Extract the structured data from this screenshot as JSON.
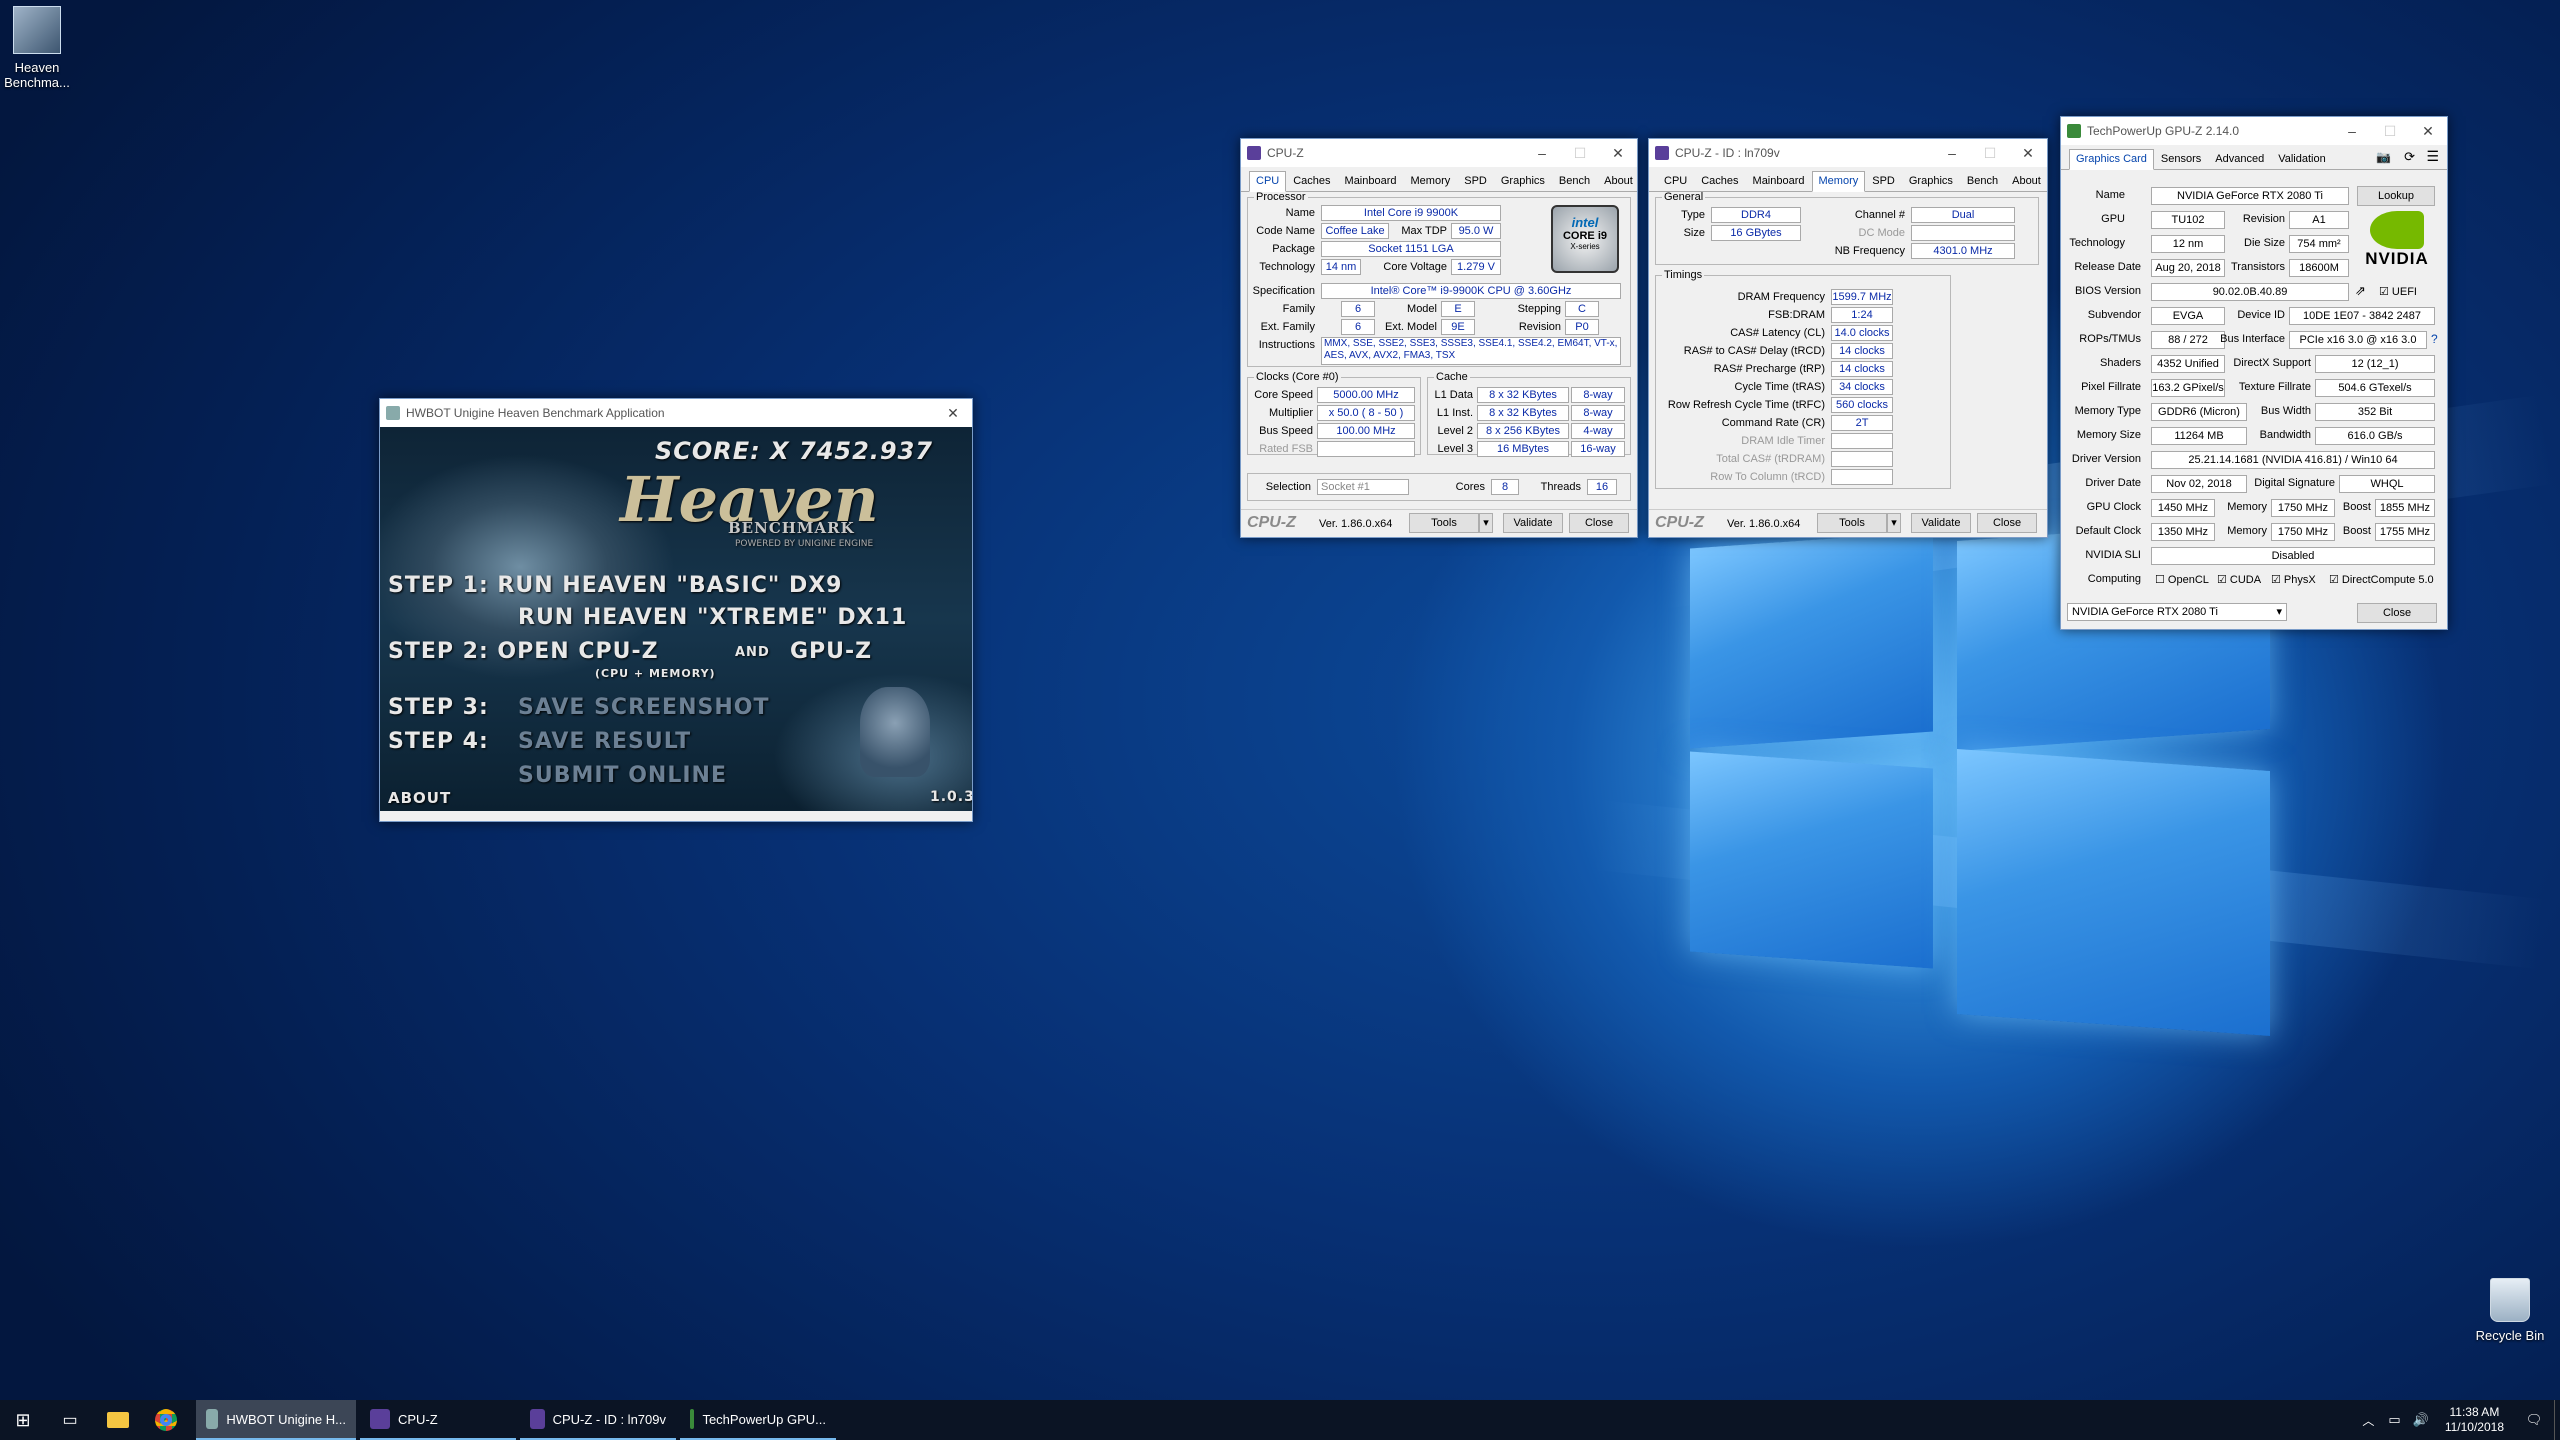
{
  "desktop": {
    "icons": [
      {
        "label": "Heaven Benchma..."
      },
      {
        "label": "Recycle Bin"
      }
    ]
  },
  "heaven": {
    "title": "HWBOT Unigine Heaven Benchmark Application",
    "score": "SCORE: X 7452.937",
    "logo": "Heaven",
    "logo_sub": "BENCHMARK",
    "logo_by": "POWERED BY UNIGINE ENGINE",
    "step1a": "STEP 1:  RUN HEAVEN \"BASIC\" DX9",
    "step1b": "RUN HEAVEN \"XTREME\" DX11",
    "step2": "STEP 2: OPEN CPU-Z",
    "step2and": "AND",
    "step2b": "GPU-Z",
    "step2sub": "(CPU + MEMORY)",
    "step3": "STEP 3:",
    "step3b": "SAVE SCREENSHOT",
    "step4": "STEP 4:",
    "step4b": "SAVE RESULT",
    "submit": "SUBMIT ONLINE",
    "about": "ABOUT",
    "version": "1.0.3"
  },
  "cpuz1": {
    "title": "CPU-Z",
    "tabs": [
      "CPU",
      "Caches",
      "Mainboard",
      "Memory",
      "SPD",
      "Graphics",
      "Bench",
      "About"
    ],
    "processor": "Processor",
    "name_l": "Name",
    "name": "Intel Core i9 9900K",
    "codename_l": "Code Name",
    "codename": "Coffee Lake",
    "maxtdp_l": "Max TDP",
    "maxtdp": "95.0 W",
    "package_l": "Package",
    "package": "Socket 1151 LGA",
    "tech_l": "Technology",
    "tech": "14 nm",
    "cv_l": "Core Voltage",
    "cv": "1.279 V",
    "spec_l": "Specification",
    "spec": "Intel® Core™ i9-9900K CPU @ 3.60GHz",
    "family_l": "Family",
    "family": "6",
    "model_l": "Model",
    "model": "E",
    "stepping_l": "Stepping",
    "stepping": "C",
    "extfam_l": "Ext. Family",
    "extfam": "6",
    "extmodel_l": "Ext. Model",
    "extmodel": "9E",
    "rev_l": "Revision",
    "rev": "P0",
    "instr_l": "Instructions",
    "instr1": "MMX, SSE, SSE2, SSE3, SSSE3, SSE4.1, SSE4.2, EM64T, VT-x,",
    "instr2": "AES, AVX, AVX2, FMA3, TSX",
    "clocks": "Clocks (Core #0)",
    "cache": "Cache",
    "corespeed_l": "Core Speed",
    "corespeed": "5000.00 MHz",
    "mult_l": "Multiplier",
    "mult": "x 50.0 ( 8 - 50 )",
    "bus_l": "Bus Speed",
    "bus": "100.00 MHz",
    "ratedfsb_l": "Rated FSB",
    "l1d_l": "L1 Data",
    "l1d": "8 x 32 KBytes",
    "l1d_w": "8-way",
    "l1i_l": "L1 Inst.",
    "l1i": "8 x 32 KBytes",
    "l1i_w": "8-way",
    "l2_l": "Level 2",
    "l2": "8 x 256 KBytes",
    "l2_w": "4-way",
    "l3_l": "Level 3",
    "l3": "16 MBytes",
    "l3_w": "16-way",
    "selection_l": "Selection",
    "selection": "Socket #1",
    "cores_l": "Cores",
    "cores": "8",
    "threads_l": "Threads",
    "threads": "16",
    "logo": "CPU-Z",
    "version": "Ver. 1.86.0.x64",
    "tools": "Tools",
    "validate": "Validate",
    "close": "Close",
    "intel_badge": "intel",
    "intel_core": "CORE i9",
    "intel_x": "X-series"
  },
  "cpuz2": {
    "title": "CPU-Z - ID : ln709v",
    "tabs": [
      "CPU",
      "Caches",
      "Mainboard",
      "Memory",
      "SPD",
      "Graphics",
      "Bench",
      "About"
    ],
    "general": "General",
    "type_l": "Type",
    "type": "DDR4",
    "channel_l": "Channel #",
    "channel": "Dual",
    "size_l": "Size",
    "size": "16 GBytes",
    "dcmode_l": "DC Mode",
    "nbfreq_l": "NB Frequency",
    "nbfreq": "4301.0 MHz",
    "timings": "Timings",
    "t": [
      {
        "l": "DRAM Frequency",
        "v": "1599.7 MHz"
      },
      {
        "l": "FSB:DRAM",
        "v": "1:24"
      },
      {
        "l": "CAS# Latency (CL)",
        "v": "14.0 clocks"
      },
      {
        "l": "RAS# to CAS# Delay (tRCD)",
        "v": "14 clocks"
      },
      {
        "l": "RAS# Precharge (tRP)",
        "v": "14 clocks"
      },
      {
        "l": "Cycle Time (tRAS)",
        "v": "34 clocks"
      },
      {
        "l": "Row Refresh Cycle Time (tRFC)",
        "v": "560 clocks"
      },
      {
        "l": "Command Rate (CR)",
        "v": "2T"
      },
      {
        "l": "DRAM Idle Timer",
        "v": ""
      },
      {
        "l": "Total CAS# (tRDRAM)",
        "v": ""
      },
      {
        "l": "Row To Column (tRCD)",
        "v": ""
      }
    ],
    "logo": "CPU-Z",
    "version": "Ver. 1.86.0.x64",
    "tools": "Tools",
    "validate": "Validate",
    "close": "Close"
  },
  "gpuz": {
    "title": "TechPowerUp GPU-Z 2.14.0",
    "tabs": [
      "Graphics Card",
      "Sensors",
      "Advanced",
      "Validation"
    ],
    "name_l": "Name",
    "name": "NVIDIA GeForce RTX 2080 Ti",
    "lookup": "Lookup",
    "gpu_l": "GPU",
    "gpu": "TU102",
    "rev_l": "Revision",
    "rev": "A1",
    "tech_l": "Technology",
    "tech": "12 nm",
    "die_l": "Die Size",
    "die": "754 mm²",
    "release_l": "Release Date",
    "release": "Aug 20, 2018",
    "trans_l": "Transistors",
    "trans": "18600M",
    "bios_l": "BIOS Version",
    "bios": "90.02.0B.40.89",
    "uefi": "UEFI",
    "subv_l": "Subvendor",
    "subv": "EVGA",
    "devid_l": "Device ID",
    "devid": "10DE 1E07 - 3842 2487",
    "rops_l": "ROPs/TMUs",
    "rops": "88 / 272",
    "busif_l": "Bus Interface",
    "busif": "PCIe x16 3.0 @ x16 3.0",
    "shaders_l": "Shaders",
    "shaders": "4352 Unified",
    "dx_l": "DirectX Support",
    "dx": "12 (12_1)",
    "pixel_l": "Pixel Fillrate",
    "pixel": "163.2 GPixel/s",
    "texture_l": "Texture Fillrate",
    "texture": "504.6 GTexel/s",
    "memtype_l": "Memory Type",
    "memtype": "GDDR6 (Micron)",
    "buswidth_l": "Bus Width",
    "buswidth": "352 Bit",
    "memsize_l": "Memory Size",
    "memsize": "11264 MB",
    "bw_l": "Bandwidth",
    "bw": "616.0 GB/s",
    "driver_l": "Driver Version",
    "driver": "25.21.14.1681 (NVIDIA 416.81) / Win10 64",
    "ddate_l": "Driver Date",
    "ddate": "Nov 02, 2018",
    "dsig_l": "Digital Signature",
    "dsig": "WHQL",
    "gpuclk_l": "GPU Clock",
    "gpuclk": "1450 MHz",
    "mem_l": "Memory",
    "mem": "1750 MHz",
    "boost_l": "Boost",
    "boost": "1855 MHz",
    "defclk_l": "Default Clock",
    "defclk": "1350 MHz",
    "dmem": "1750 MHz",
    "dboost": "1755 MHz",
    "sli_l": "NVIDIA SLI",
    "sli": "Disabled",
    "comp_l": "Computing",
    "opencl": "OpenCL",
    "cuda": "CUDA",
    "physx": "PhysX",
    "dc": "DirectCompute 5.0",
    "select": "NVIDIA GeForce RTX 2080 Ti",
    "close": "Close",
    "nvidia": "NVIDIA"
  },
  "taskbar": {
    "apps": [
      "HWBOT Unigine H...",
      "CPU-Z",
      "CPU-Z - ID : ln709v",
      "TechPowerUp GPU..."
    ],
    "time": "11:38 AM",
    "date": "11/10/2018"
  },
  "colors": {
    "accent": "#76b9ed",
    "value_blue": "#0a2aa8",
    "nvidia_green": "#76b900"
  }
}
